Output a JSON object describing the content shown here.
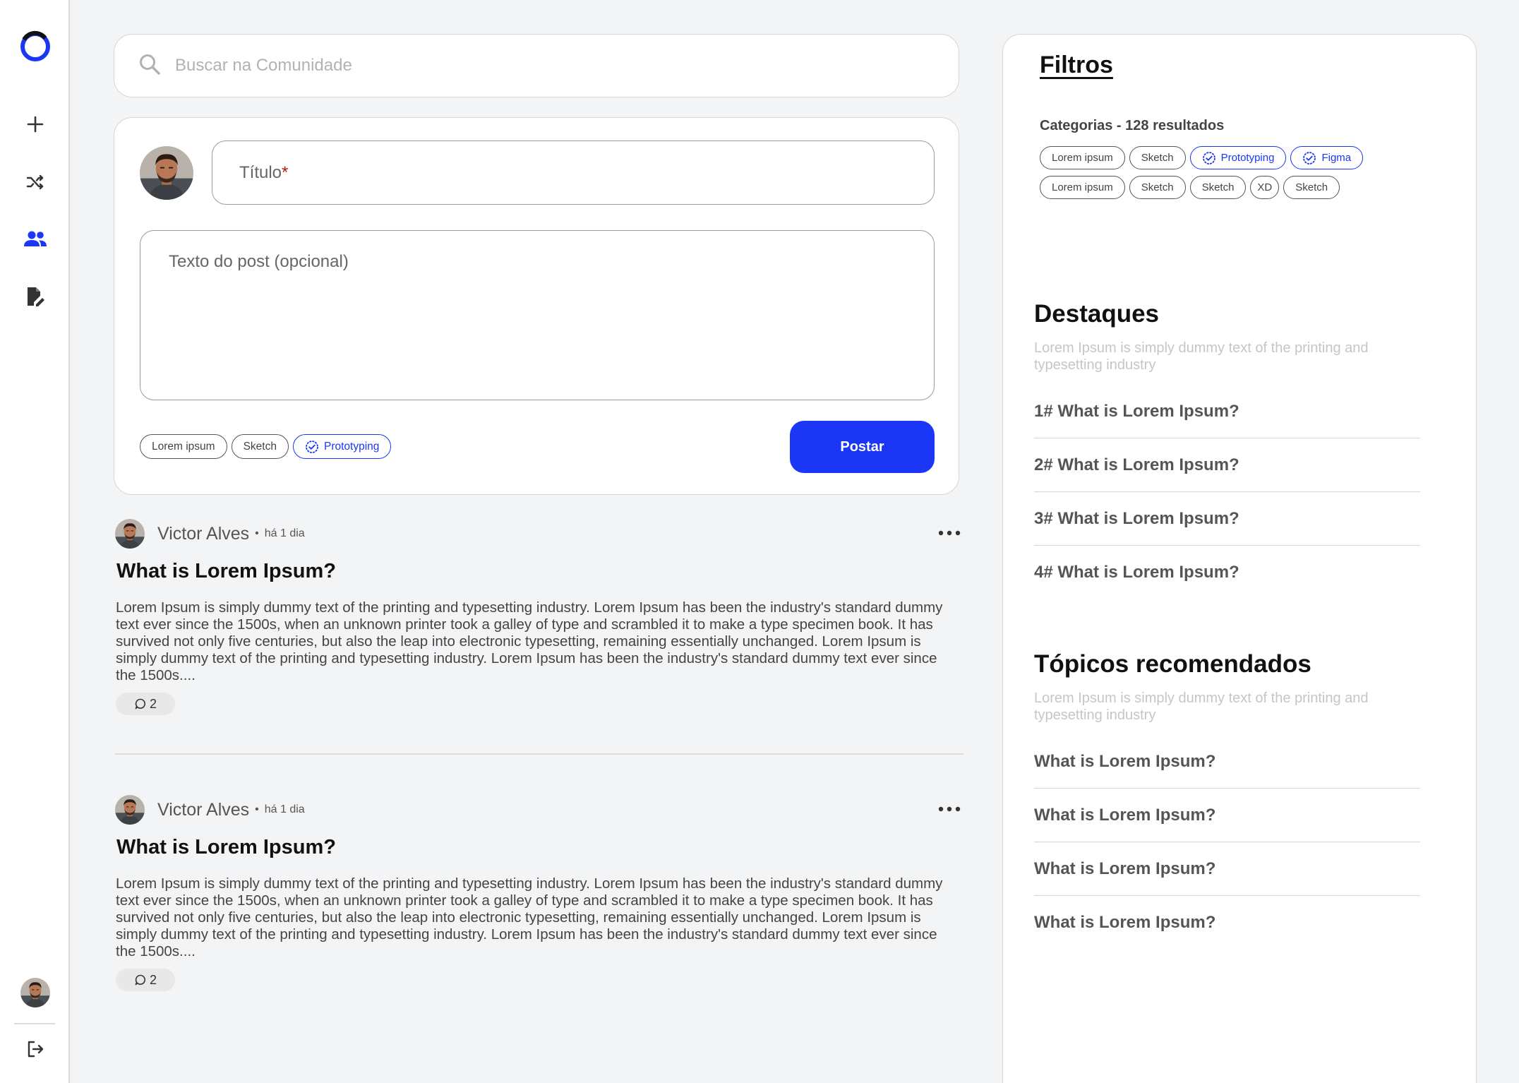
{
  "search": {
    "placeholder": "Buscar na Comunidade"
  },
  "composer": {
    "title_placeholder": "Título",
    "title_required_mark": "*",
    "body_placeholder": "Texto do post (opcional)",
    "tags": [
      {
        "label": "Lorem ipsum",
        "selected": false
      },
      {
        "label": "Sketch",
        "selected": false
      },
      {
        "label": "Prototyping",
        "selected": true
      }
    ],
    "post_button": "Postar"
  },
  "posts": [
    {
      "author": "Victor Alves",
      "separator": "•",
      "time": "há 1 dia",
      "title": "What is Lorem Ipsum?",
      "body": "Lorem Ipsum is simply dummy text of the printing and typesetting industry. Lorem Ipsum has been the industry's standard dummy text ever since the 1500s, when an unknown printer took a galley of type and scrambled it to make a type specimen book. It has survived not only five centuries, but also the leap into electronic typesetting, remaining essentially unchanged. Lorem Ipsum is simply dummy text of the printing and typesetting industry. Lorem Ipsum has been the industry's standard dummy text ever since the 1500s....",
      "comments": "2"
    },
    {
      "author": "Victor Alves",
      "separator": "•",
      "time": "há 1 dia",
      "title": "What is Lorem Ipsum?",
      "body": "Lorem Ipsum is simply dummy text of the printing and typesetting industry. Lorem Ipsum has been the industry's standard dummy text ever since the 1500s, when an unknown printer took a galley of type and scrambled it to make a type specimen book. It has survived not only five centuries, but also the leap into electronic typesetting, remaining essentially unchanged. Lorem Ipsum is simply dummy text of the printing and typesetting industry. Lorem Ipsum has been the industry's standard dummy text ever since the 1500s....",
      "comments": "2"
    }
  ],
  "filters": {
    "title": "Filtros",
    "categories_label": "Categorias - 128 resultados",
    "tags": [
      {
        "label": "Lorem ipsum",
        "selected": false
      },
      {
        "label": "Sketch",
        "selected": false
      },
      {
        "label": "Prototyping",
        "selected": true
      },
      {
        "label": "Figma",
        "selected": true
      },
      {
        "label": "Lorem ipsum",
        "selected": false
      },
      {
        "label": "Sketch",
        "selected": false
      },
      {
        "label": "Sketch",
        "selected": false
      },
      {
        "label": "XD",
        "selected": false
      },
      {
        "label": "Sketch",
        "selected": false
      }
    ]
  },
  "highlights": {
    "title": "Destaques",
    "subtitle": "Lorem Ipsum is simply dummy text of the printing and typesetting industry",
    "items": [
      "1# What is Lorem Ipsum?",
      "2# What is Lorem Ipsum?",
      "3# What is Lorem Ipsum?",
      "4# What is Lorem Ipsum?"
    ]
  },
  "recommended": {
    "title": "Tópicos recomendados",
    "subtitle": "Lorem Ipsum is simply dummy text of the printing and typesetting industry",
    "items": [
      "What is Lorem Ipsum?",
      "What is Lorem Ipsum?",
      "What is Lorem Ipsum?",
      "What is Lorem Ipsum?"
    ]
  },
  "sidebar": {
    "icons": [
      "logo-icon",
      "plus-icon",
      "shuffle-icon",
      "community-icon",
      "edit-document-icon",
      "avatar",
      "logout-icon"
    ],
    "active": "community-icon"
  },
  "colors": {
    "accent": "#1b37f5",
    "background": "#f3f4f6",
    "required": "#b11a1a"
  }
}
